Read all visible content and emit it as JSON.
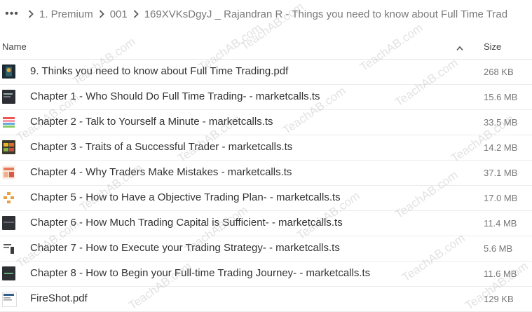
{
  "breadcrumb": {
    "items": [
      "1. Premium",
      "001",
      "169XVKsDgyJ _ Rajandran R - Things you need to know about Full Time Trad"
    ]
  },
  "header": {
    "name_label": "Name",
    "size_label": "Size"
  },
  "files": [
    {
      "name": "9. Thinks you need to know about Full Time Trading.pdf",
      "size": "268 KB"
    },
    {
      "name": "Chapter 1 - Who Should Do Full Time Trading- - marketcalls.ts",
      "size": "15.6 MB"
    },
    {
      "name": "Chapter 2 - Talk to Yourself a Minute - marketcalls.ts",
      "size": "33.5 MB"
    },
    {
      "name": "Chapter 3 - Traits of a Successful Trader - marketcalls.ts",
      "size": "14.2 MB"
    },
    {
      "name": "Chapter 4 - Why Traders Make Mistakes - marketcalls.ts",
      "size": "37.1 MB"
    },
    {
      "name": "Chapter 5 - How to Have a Objective Trading Plan- - marketcalls.ts",
      "size": "17.0 MB"
    },
    {
      "name": "Chapter 6 - How Much Trading Capital is Sufficient- - marketcalls.ts",
      "size": "11.4 MB"
    },
    {
      "name": "Chapter 7 - How to Execute your Trading Strategy- - marketcalls.ts",
      "size": "5.6 MB"
    },
    {
      "name": "Chapter 8 - How to Begin your Full-time Trading Journey- - marketcalls.ts",
      "size": "11.6 MB"
    },
    {
      "name": "FireShot.pdf",
      "size": "129 KB"
    }
  ],
  "watermark": "TeachAB.com"
}
